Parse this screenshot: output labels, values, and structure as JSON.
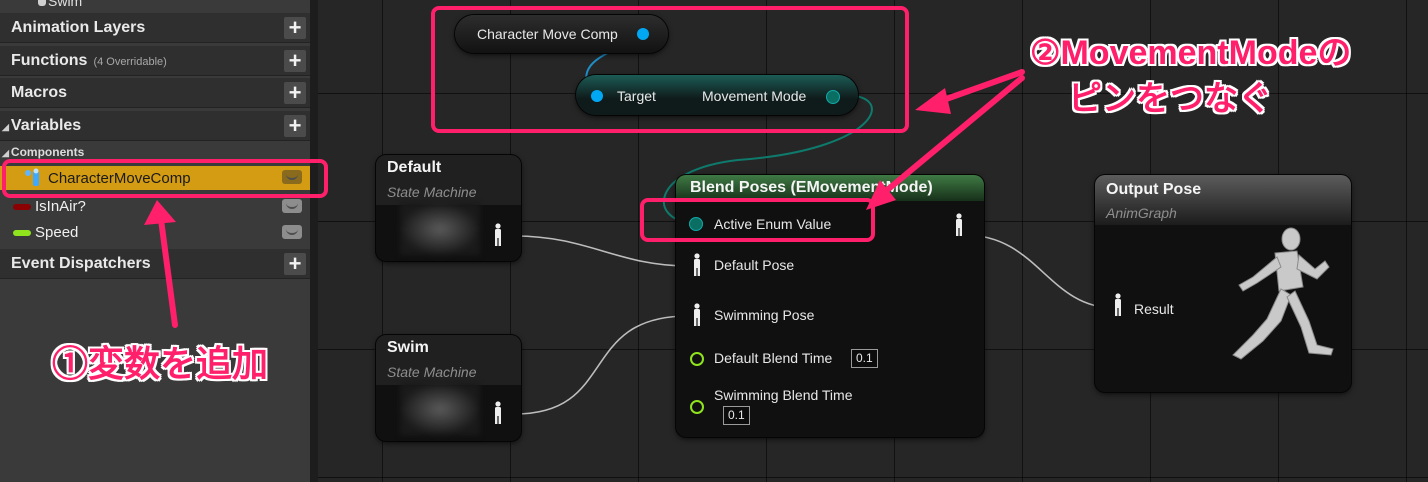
{
  "left_panel": {
    "top_item": "Swim",
    "sections": {
      "animation_layers": "Animation Layers",
      "functions": "Functions",
      "functions_sub": "(4 Overridable)",
      "macros": "Macros",
      "variables": "Variables",
      "event_dispatchers": "Event Dispatchers"
    },
    "components_label": "Components",
    "variables": [
      {
        "name": "CharacterMoveComp",
        "color": "#3fa8ff"
      },
      {
        "name": "IsInAir?",
        "color": "#8b0000"
      },
      {
        "name": "Speed",
        "color": "#8fe41d"
      }
    ]
  },
  "graph": {
    "getter_node": {
      "label": "Character Move Comp"
    },
    "movement_node": {
      "target": "Target",
      "output": "Movement Mode"
    },
    "default_sm": {
      "title": "Default",
      "subtitle": "State Machine"
    },
    "swim_sm": {
      "title": "Swim",
      "subtitle": "State Machine"
    },
    "blend_node": {
      "title": "Blend Poses (EMovementMode)",
      "pins": {
        "active_enum": "Active Enum Value",
        "default_pose": "Default Pose",
        "swimming_pose": "Swimming Pose",
        "default_blend_time": "Default Blend Time",
        "default_blend_value": "0.1",
        "swimming_blend_time": "Swimming Blend Time",
        "swimming_blend_value": "0.1"
      }
    },
    "output_node": {
      "title": "Output Pose",
      "subtitle": "AnimGraph",
      "pin": "Result"
    }
  },
  "annotations": {
    "step1": "①変数を追加",
    "step2_line1": "②MovementModeの",
    "step2_line2": "ピンをつなぐ"
  },
  "colors": {
    "highlight": "#ff1f6a",
    "object_pin": "#00a8f3",
    "enum_pin": "#0b6e62",
    "float_pin": "#8fe41d",
    "selected_row": "#d49c12"
  }
}
